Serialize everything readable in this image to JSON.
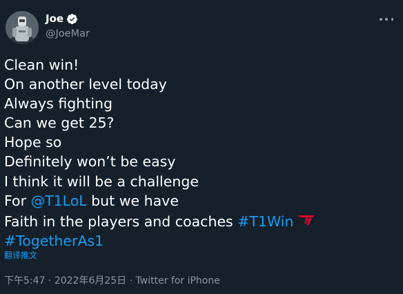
{
  "author": {
    "display_name": "Joe",
    "handle": "@JoeMar",
    "avatar_icon": "robot-avatar",
    "verified_icon": "verified-badge-icon"
  },
  "more_icon": "more-options-icon",
  "tweet": {
    "lines": [
      "Clean win!",
      "On another level today",
      "Always fighting",
      "Can we get 25?",
      "Hope so",
      "Definitely won’t be easy",
      "I think it will be a challenge"
    ],
    "line8_prefix": "For ",
    "mention": "@T1LoL",
    "line8_suffix": " but we have",
    "line9_prefix": "Faith in the players and coaches ",
    "hashtag1": "#T1Win",
    "t1_emoji_icon": "t1-logo-icon",
    "hashtag2": "#TogetherAs1"
  },
  "translate_label": "翻译推文",
  "meta": {
    "time": "下午5:47",
    "separator1": " · ",
    "date": "2022年6月25日",
    "separator2": " · ",
    "source": "Twitter for iPhone"
  },
  "colors": {
    "background": "#15202b",
    "link": "#1d9bf0",
    "secondary_text": "#8b98a5",
    "t1_red": "#e2012d"
  }
}
